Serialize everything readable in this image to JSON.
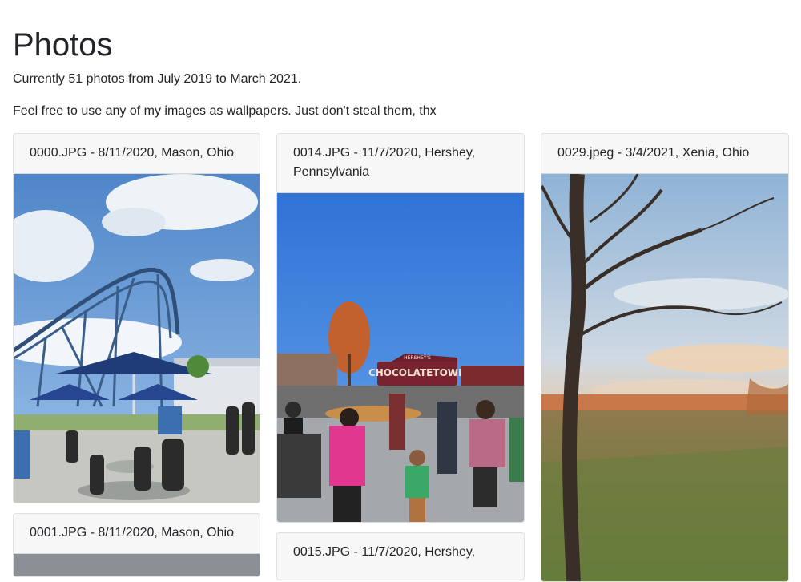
{
  "page": {
    "title": "Photos",
    "intro_count": "Currently 51 photos from July 2019 to March 2021.",
    "intro_note": "Feel free to use any of my images as wallpapers. Just don't steal them, thx"
  },
  "photos": [
    {
      "caption": "0000.JPG - 8/11/2020, Mason, Ohio"
    },
    {
      "caption": "0014.JPG - 11/7/2020, Hershey, Pennsylvania"
    },
    {
      "caption": "0029.jpeg - 3/4/2021, Xenia, Ohio"
    },
    {
      "caption": "0001.JPG - 8/11/2020, Mason, Ohio"
    },
    {
      "caption": "0015.JPG - 11/7/2020, Hershey,"
    }
  ],
  "signage": {
    "brand": "HERSHEY'S",
    "sign": "CHOCOLATETOWN"
  }
}
